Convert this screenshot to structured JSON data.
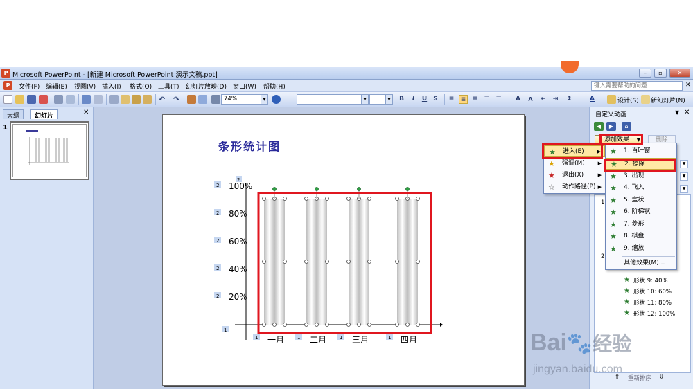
{
  "window": {
    "title": "Microsoft PowerPoint - [新建 Microsoft PowerPoint 演示文稿.ppt]"
  },
  "menubar": {
    "items": [
      "文件(F)",
      "编辑(E)",
      "视图(V)",
      "插入(I)",
      "格式(O)",
      "工具(T)",
      "幻灯片放映(D)",
      "窗口(W)",
      "帮助(H)"
    ],
    "help_placeholder": "键入需要帮助的问题"
  },
  "toolbar": {
    "zoom": "74%",
    "design_label": "设计(S)",
    "new_slide_label": "新幻灯片(N)"
  },
  "leftpanel": {
    "tabs": [
      "大纲",
      "幻灯片"
    ],
    "slide_number": "1"
  },
  "slide": {
    "title": "条形统计图"
  },
  "chart_data": {
    "type": "bar",
    "title": "条形统计图",
    "categories": [
      "一月",
      "二月",
      "三月",
      "四月"
    ],
    "y_ticks": [
      "20%",
      "40%",
      "60%",
      "80%",
      "100%"
    ],
    "ylim": [
      0,
      100
    ],
    "values": [
      100,
      100,
      100,
      100
    ],
    "order_tags_y": [
      "2",
      "2",
      "2",
      "2",
      "2"
    ],
    "order_tags_top": "2",
    "order_tags_x": [
      "1",
      "1",
      "1",
      "1"
    ],
    "order_tag_origin": "1"
  },
  "taskpane": {
    "title": "自定义动画",
    "add_effect": "添加效果",
    "delete": "删除",
    "group_numbers": [
      "1",
      "2"
    ],
    "list_items": [
      "形状 9: 40%",
      "形状 10: 60%",
      "形状 11: 80%",
      "形状 12: 100%"
    ],
    "reorder": "重新排序"
  },
  "menu1": {
    "items": [
      {
        "label": "进入(E)",
        "icon": "enter-star-icon"
      },
      {
        "label": "强调(M)",
        "icon": "emphasis-star-icon"
      },
      {
        "label": "退出(X)",
        "icon": "exit-star-icon"
      },
      {
        "label": "动作路径(P)",
        "icon": "motion-path-icon"
      }
    ]
  },
  "menu2": {
    "items": [
      "1. 百叶窗",
      "2. 擦除",
      "3. 出现",
      "4. 飞入",
      "5. 盒状",
      "6. 阶梯状",
      "7. 菱形",
      "8. 棋盘",
      "9. 缩放",
      "其他效果(M)..."
    ]
  },
  "watermark": {
    "logo": "Bai",
    "logo_tail": "经验",
    "sub": "jingyan.baidu.com"
  }
}
